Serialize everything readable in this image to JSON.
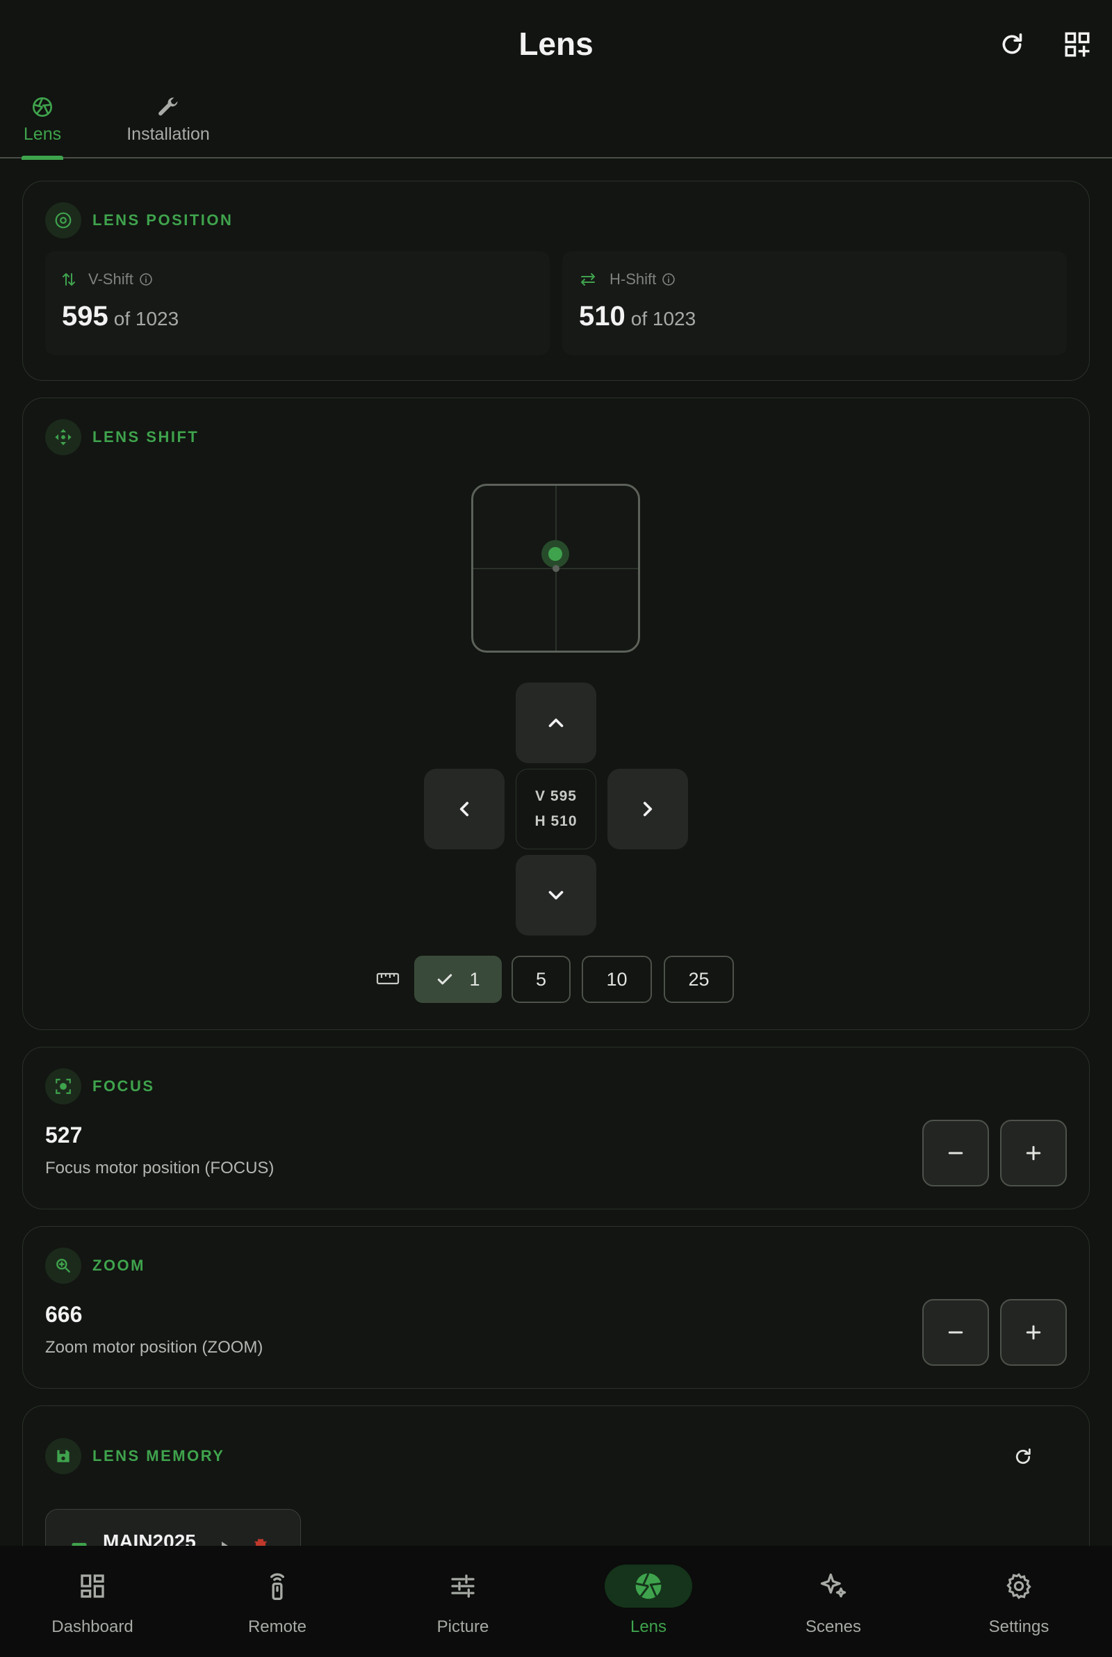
{
  "header": {
    "title": "Lens",
    "refresh_icon": "refresh-icon",
    "add_widget_icon": "qr-add-icon"
  },
  "tabs": [
    {
      "label": "Lens",
      "icon": "aperture-icon",
      "active": true
    },
    {
      "label": "Installation",
      "icon": "wrench-icon",
      "active": false
    }
  ],
  "lens_position": {
    "title": "LENS POSITION",
    "v_shift": {
      "label": "V-Shift",
      "value": "595",
      "of": "of 1023"
    },
    "h_shift": {
      "label": "H-Shift",
      "value": "510",
      "of": "of 1023"
    }
  },
  "lens_shift": {
    "title": "LENS SHIFT",
    "readout_v": "V 595",
    "readout_h": "H 510",
    "steps": [
      "1",
      "5",
      "10",
      "25"
    ],
    "selected_step": "1"
  },
  "focus": {
    "title": "FOCUS",
    "value": "527",
    "description": "Focus motor position (FOCUS)"
  },
  "zoom": {
    "title": "ZOOM",
    "value": "666",
    "description": "Zoom motor position (ZOOM)"
  },
  "lens_memory": {
    "title": "LENS MEMORY",
    "items": [
      {
        "name": "MAIN2025"
      }
    ]
  },
  "bottom_nav": [
    {
      "label": "Dashboard",
      "icon": "dashboard-icon"
    },
    {
      "label": "Remote",
      "icon": "remote-icon"
    },
    {
      "label": "Picture",
      "icon": "sliders-icon"
    },
    {
      "label": "Lens",
      "icon": "aperture-icon",
      "active": true
    },
    {
      "label": "Scenes",
      "icon": "sparkles-icon"
    },
    {
      "label": "Settings",
      "icon": "gear-icon"
    }
  ],
  "colors": {
    "accent": "#3fa34d",
    "background": "#111410",
    "card_border": "#2c322b"
  }
}
